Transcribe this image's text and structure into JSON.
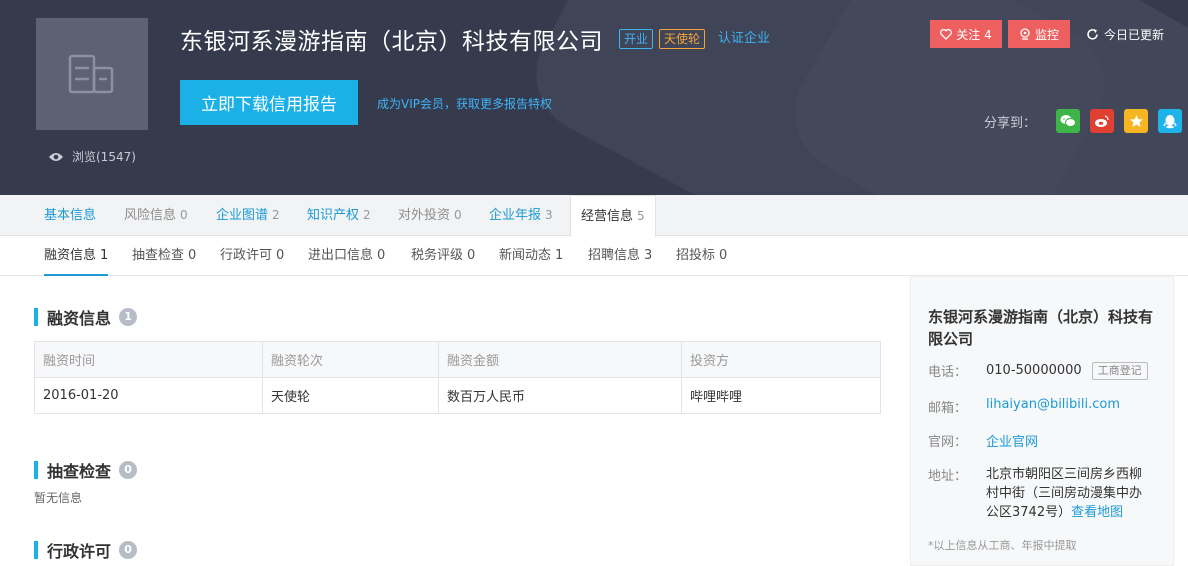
{
  "header": {
    "company_name": "东银河系漫游指南（北京）科技有限公司",
    "tags": {
      "status": "开业",
      "round": "天使轮",
      "certified": "认证企业"
    },
    "views": "浏览(1547)",
    "download_button": "立即下载信用报告",
    "vip_link": "成为VIP会员，获取更多报告特权",
    "follow_button": "关注 4",
    "monitor_button": "监控",
    "updated_label": "今日已更新",
    "share_label": "分享到："
  },
  "main_tabs": [
    {
      "label": "基本信息",
      "count": ""
    },
    {
      "label": "风险信息",
      "count": "0"
    },
    {
      "label": "企业图谱",
      "count": "2"
    },
    {
      "label": "知识产权",
      "count": "2"
    },
    {
      "label": "对外投资",
      "count": "0"
    },
    {
      "label": "企业年报",
      "count": "3"
    },
    {
      "label": "经营信息",
      "count": "5"
    }
  ],
  "sub_tabs": [
    {
      "label": "融资信息",
      "count": "1"
    },
    {
      "label": "抽查检查",
      "count": "0"
    },
    {
      "label": "行政许可",
      "count": "0"
    },
    {
      "label": "进出口信息",
      "count": "0"
    },
    {
      "label": "税务评级",
      "count": "0"
    },
    {
      "label": "新闻动态",
      "count": "1"
    },
    {
      "label": "招聘信息",
      "count": "3"
    },
    {
      "label": "招投标",
      "count": "0"
    }
  ],
  "financing": {
    "title": "融资信息",
    "count": "1",
    "headers": [
      "融资时间",
      "融资轮次",
      "融资金额",
      "投资方"
    ],
    "rows": [
      [
        "2016-01-20",
        "天使轮",
        "数百万人民币",
        "哔哩哔哩"
      ]
    ]
  },
  "inspection": {
    "title": "抽查检查",
    "count": "0",
    "empty_text": "暂无信息"
  },
  "license": {
    "title": "行政许可",
    "count": "0"
  },
  "sidebar": {
    "name": "东银河系漫游指南（北京）科技有限公司",
    "phone_label": "电话：",
    "phone": "010-50000000",
    "phone_tag": "工商登记",
    "email_label": "邮箱：",
    "email": "lihaiyan@bilibili.com",
    "site_label": "官网：",
    "site": "企业官网",
    "address_label": "地址：",
    "address": "北京市朝阳区三间房乡西柳村中街（三间房动漫集中办公区3742号）",
    "map_link": "查看地图",
    "note": "*以上信息从工商、年报中提取"
  },
  "colors": {
    "accent": "#1bb0e6",
    "follow": "#ee6060",
    "header_bg": "#363a4d"
  }
}
